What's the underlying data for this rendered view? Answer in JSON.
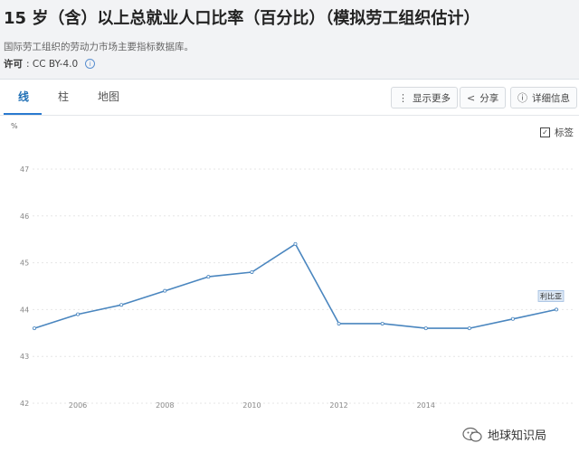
{
  "page": {
    "title": "15 岁（含）以上总就业人口比率（百分比）（模拟劳工组织估计）",
    "subtitle": "国际劳工组织的劳动力市场主要指标数据库。",
    "license_label": "许可",
    "license_value": ": CC BY-4.0"
  },
  "tabs": [
    {
      "label": "线",
      "active": true
    },
    {
      "label": "柱",
      "active": false
    },
    {
      "label": "地图",
      "active": false
    }
  ],
  "toolbar": {
    "more_label": "显示更多",
    "share_label": "分享",
    "details_label": "详细信息"
  },
  "legend_toggle": {
    "label": "标签",
    "checked": true
  },
  "watermark": "地球知识局",
  "colors": {
    "line": "#4a86bf",
    "accent": "#2a7ad0"
  },
  "chart_data": {
    "type": "line",
    "title": "15 岁（含）以上总就业人口比率（百分比）（模拟劳工组织估计）",
    "ylabel": "%",
    "xlabel": "",
    "x": [
      2005,
      2006,
      2007,
      2008,
      2009,
      2010,
      2011,
      2012,
      2013,
      2014,
      2015,
      2016,
      2017
    ],
    "series": [
      {
        "name": "利比亚",
        "values": [
          43.6,
          43.9,
          44.1,
          44.4,
          44.7,
          44.8,
          45.4,
          43.7,
          43.7,
          43.6,
          43.6,
          43.8,
          44.0
        ]
      }
    ],
    "ylim": [
      42,
      47
    ],
    "yticks": [
      42,
      43,
      44,
      45,
      46,
      47
    ],
    "xticks": [
      2006,
      2008,
      2010,
      2012,
      2014
    ],
    "grid": "horizontal-dotted",
    "legend": "end-of-line label"
  }
}
